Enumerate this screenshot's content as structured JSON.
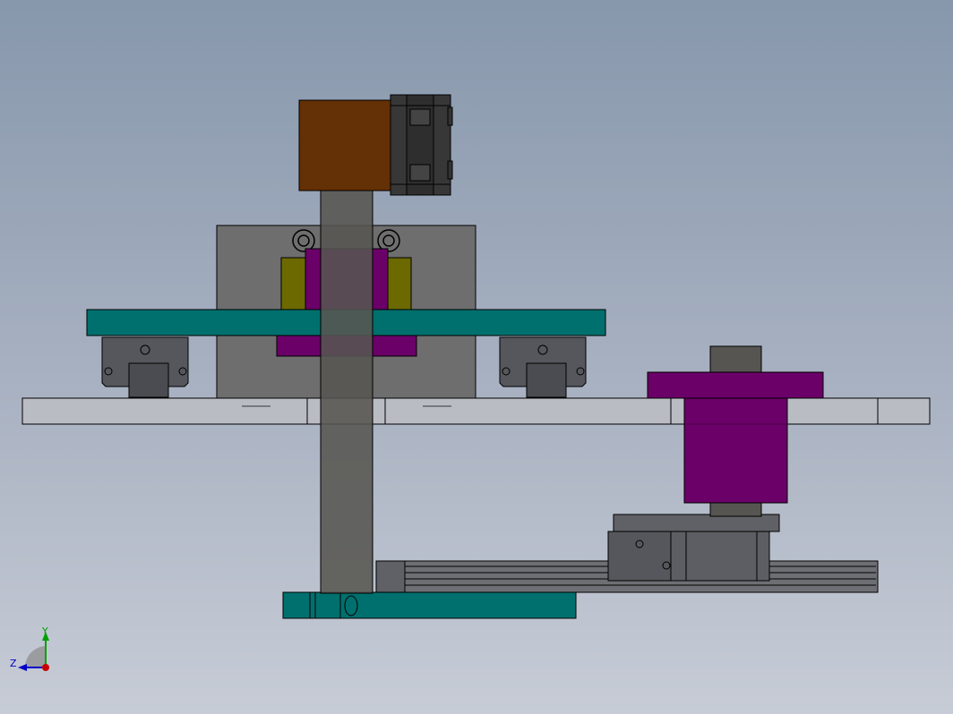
{
  "viewport": {
    "background_top": "#8797ac",
    "background_bottom": "#c7ccd6"
  },
  "model": {
    "colors": {
      "motor_body": "#643005",
      "motor_flange": "#373737",
      "mounting_plate": "#6e6e6e",
      "shaft": "#575551",
      "carriage_plate": "#00706e",
      "slider_block": "#6a0068",
      "coupling": "#6b6900",
      "linear_block": "#55575c",
      "base_rail": "#b9bcc3",
      "lower_rail": "#6d6f74",
      "outline": "#000000"
    },
    "parts": [
      "servo-motor",
      "motor-flange",
      "vertical-shaft",
      "mounting-plate",
      "shaft-coupling",
      "upper-slider-block",
      "carriage-plate",
      "lower-slider-block",
      "linear-guide-block-left",
      "linear-guide-block-right",
      "base-rail",
      "right-vertical-shaft",
      "right-slider-block",
      "lower-linear-guide",
      "base-carriage-plate"
    ]
  },
  "triad": {
    "y_label": "Y",
    "z_label": "Z",
    "y_color": "#00a000",
    "z_color": "#0000c8",
    "x_color": "#c80000"
  }
}
